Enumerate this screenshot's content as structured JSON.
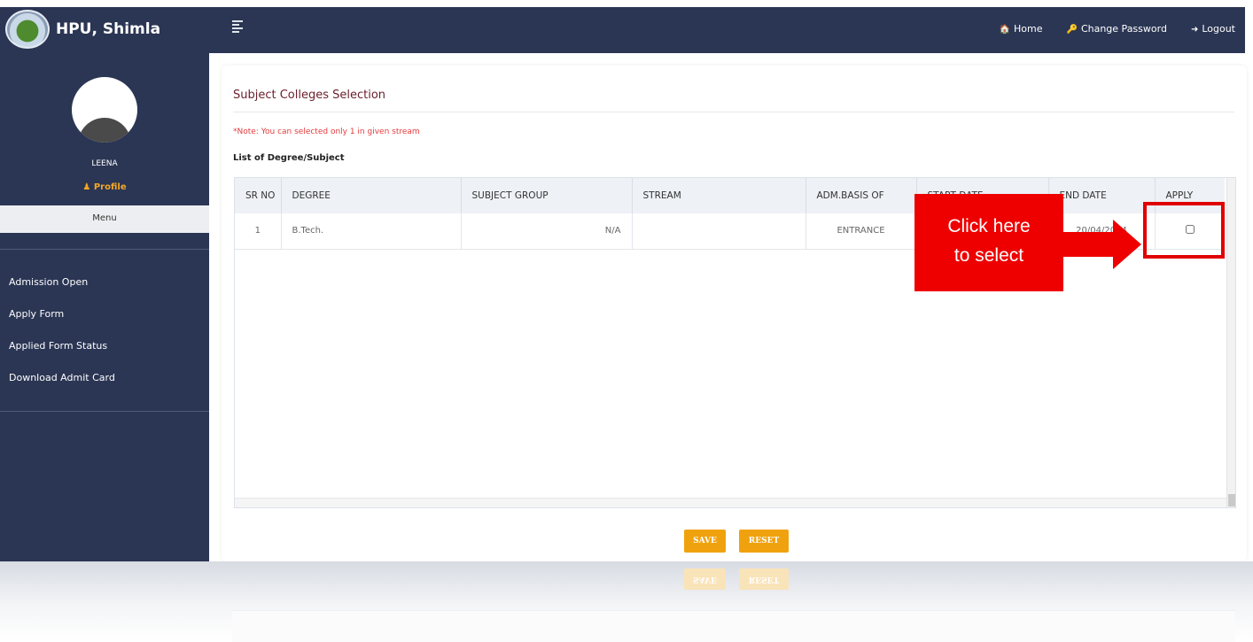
{
  "header": {
    "brand": "HPU, Shimla",
    "nav": [
      {
        "icon": "home-icon",
        "glyph": "🏠",
        "label": "Home"
      },
      {
        "icon": "key-icon",
        "glyph": "🔑",
        "label": "Change Password"
      },
      {
        "icon": "logout-icon",
        "glyph": "➜",
        "label": "Logout"
      }
    ]
  },
  "sidebar": {
    "user_name": "LEENA",
    "profile_label": "Profile",
    "menu_label": "Menu",
    "items": [
      "Admission Open",
      "Apply Form",
      "Applied Form Status",
      "Download Admit Card"
    ]
  },
  "main": {
    "title": "Subject Colleges Selection",
    "note": "*Note: You can selected only 1 in given stream",
    "list_label": "List of Degree/Subject",
    "table": {
      "columns": [
        "SR NO",
        "DEGREE",
        "SUBJECT GROUP",
        "STREAM",
        "ADM.BASIS OF",
        "START DATE",
        "END DATE",
        "APPLY"
      ],
      "rows": [
        {
          "sr_no": "1",
          "degree": "B.Tech.",
          "subject_group": "N/A",
          "stream": "",
          "adm_basis": "ENTRANCE",
          "start_date": "",
          "end_date": "20/04/2024",
          "apply": false
        }
      ]
    },
    "save_label": "SAVE",
    "reset_label": "RESET"
  },
  "annotation": {
    "callout_line1": "Click here",
    "callout_line2": "to select",
    "color": "#ee0000"
  },
  "colors": {
    "header_bg": "#2b3654",
    "accent_button": "#f0a20e",
    "title_color": "#6b1d2a",
    "note_color": "#e53b3b"
  }
}
